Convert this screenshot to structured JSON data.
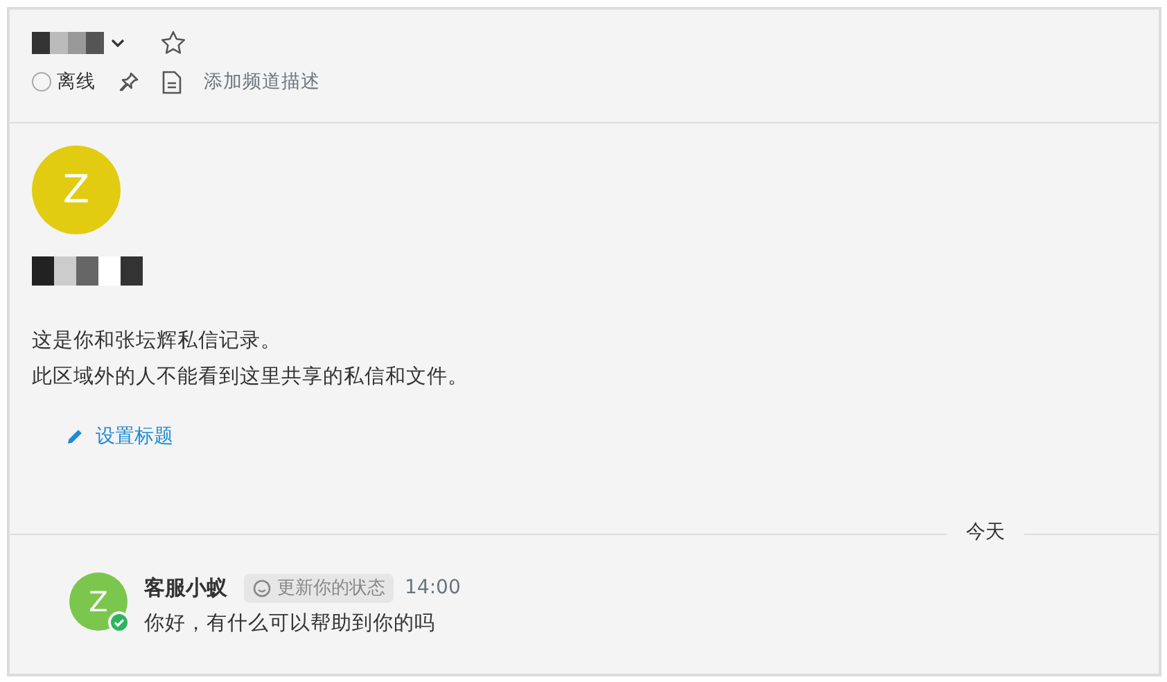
{
  "header": {
    "starred": false,
    "status": {
      "label": "离线",
      "online": false
    },
    "description_placeholder": "添加频道描述"
  },
  "intro": {
    "avatar_letter": "Z",
    "color": "#e2cc12",
    "lines": [
      "这是你和张坛辉私信记录。",
      "此区域外的人不能看到这里共享的私信和文件。"
    ],
    "set_title": "设置标题"
  },
  "divider": "今天",
  "messages": [
    {
      "avatar_letter": "Z",
      "color": "#7bc74d",
      "verified": true,
      "author": "客服小蚁",
      "status_chip": "更新你的状态",
      "time": "14:00",
      "text": "你好，有什么可以帮助到你的吗"
    }
  ]
}
